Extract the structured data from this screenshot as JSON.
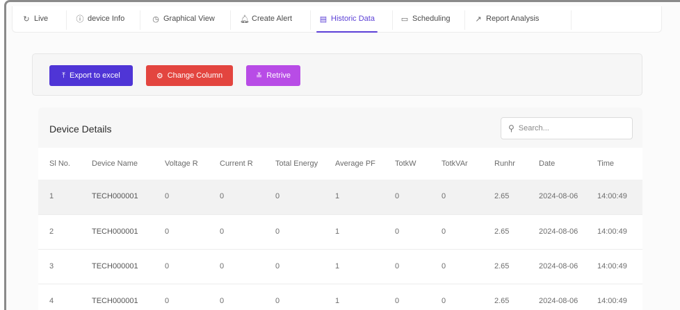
{
  "tabs": [
    {
      "label": "Live",
      "icon": "refresh-icon",
      "glyph": "↻"
    },
    {
      "label": "device Info",
      "icon": "info-icon",
      "glyph": "ⓘ"
    },
    {
      "label": "Graphical View",
      "icon": "chart-clock-icon",
      "glyph": "◷"
    },
    {
      "label": "Create Alert",
      "icon": "bell-icon",
      "glyph": "🔔︎"
    },
    {
      "label": "Historic Data",
      "icon": "document-icon",
      "glyph": "▤"
    },
    {
      "label": "Scheduling",
      "icon": "calendar-icon",
      "glyph": "▭"
    },
    {
      "label": "Report Analysis",
      "icon": "line-chart-icon",
      "glyph": "↗"
    }
  ],
  "active_tab": "Historic Data",
  "toolbar": {
    "export_label": "Export to excel",
    "change_label": "Change Column",
    "retrive_label": "Retrive",
    "colors": {
      "export": "#4f35d6",
      "change": "#e3453f",
      "retrive": "#b84ce6"
    }
  },
  "device_details": {
    "title": "Device Details",
    "search_placeholder": "Search...",
    "columns": [
      "Sl No.",
      "Device Name",
      "Voltage R",
      "Current R",
      "Total Energy",
      "Average PF",
      "TotkW",
      "TotkVAr",
      "Runhr",
      "Date",
      "Time"
    ],
    "rows": [
      [
        "1",
        "TECH000001",
        "0",
        "0",
        "0",
        "1",
        "0",
        "0",
        "2.65",
        "2024-08-06",
        "14:00:49"
      ],
      [
        "2",
        "TECH000001",
        "0",
        "0",
        "0",
        "1",
        "0",
        "0",
        "2.65",
        "2024-08-06",
        "14:00:49"
      ],
      [
        "3",
        "TECH000001",
        "0",
        "0",
        "0",
        "1",
        "0",
        "0",
        "2.65",
        "2024-08-06",
        "14:00:49"
      ],
      [
        "4",
        "TECH000001",
        "0",
        "0",
        "0",
        "1",
        "0",
        "0",
        "2.65",
        "2024-08-06",
        "14:00:49"
      ]
    ]
  },
  "accent": "#5b3fd6"
}
